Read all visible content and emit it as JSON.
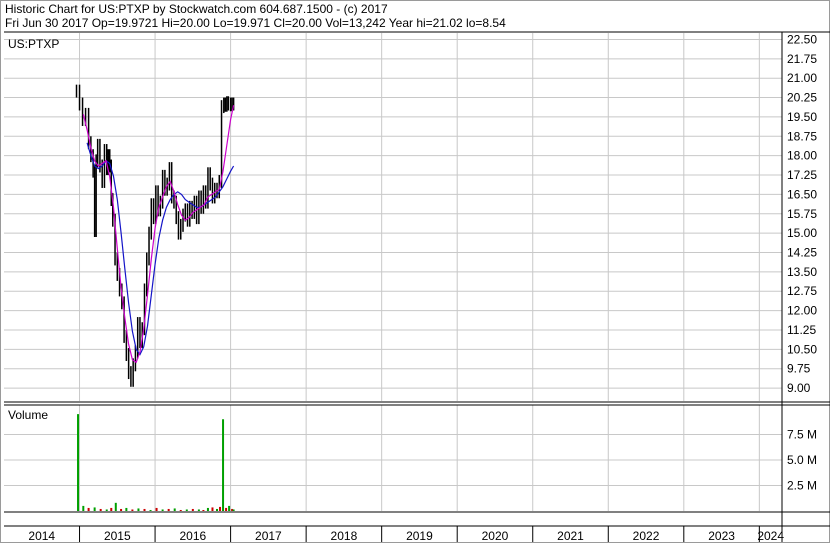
{
  "header": {
    "line1": "Historic Chart for US:PTXP by Stockwatch.com 604.687.1500 - (c) 2017",
    "line2": "Fri Jun 30 2017   Op=19.9721  Hi=20.00   Lo=19.971   Cl=20.00   Vol=13,242   Year hi=21.02   lo=8.54"
  },
  "colors": {
    "grid": "#c8c8c8",
    "price": "#000000",
    "ma_short": "#cc00cc",
    "ma_long": "#1414c8",
    "volume_up": "#00a000",
    "volume_down": "#cc0000",
    "frame": "#000000"
  },
  "chart_data": [
    {
      "type": "line",
      "title": "US:PTXP",
      "ylim": [
        8.5,
        22.75
      ],
      "yticks": [
        "22.50",
        "21.75",
        "21.00",
        "20.25",
        "19.50",
        "18.75",
        "18.00",
        "17.25",
        "16.50",
        "15.75",
        "15.00",
        "14.25",
        "13.50",
        "12.75",
        "12.00",
        "11.25",
        "10.50",
        "9.75",
        "9.00"
      ],
      "xlim": [
        2014.0,
        2024.3
      ],
      "series": [
        {
          "key": "price",
          "x": [
            2014.96,
            2015.0,
            2015.04,
            2015.08,
            2015.12,
            2015.15,
            2015.18,
            2015.2,
            2015.22,
            2015.24,
            2015.27,
            2015.3,
            2015.33,
            2015.36,
            2015.38,
            2015.4,
            2015.42,
            2015.44,
            2015.47,
            2015.5,
            2015.53,
            2015.56,
            2015.59,
            2015.62,
            2015.65,
            2015.68,
            2015.71,
            2015.74,
            2015.77,
            2015.8,
            2015.83,
            2015.86,
            2015.89,
            2015.92,
            2015.95,
            2015.98,
            2016.01,
            2016.04,
            2016.07,
            2016.1,
            2016.13,
            2016.16,
            2016.19,
            2016.22,
            2016.25,
            2016.28,
            2016.31,
            2016.34,
            2016.37,
            2016.4,
            2016.43,
            2016.46,
            2016.49,
            2016.52,
            2016.55,
            2016.58,
            2016.61,
            2016.64,
            2016.67,
            2016.7,
            2016.73,
            2016.76,
            2016.79,
            2016.82,
            2016.85,
            2016.88,
            2016.91,
            2016.93,
            2016.95,
            2016.97,
            2017.0,
            2017.02,
            2017.04
          ],
          "values": [
            20.5,
            20.0,
            19.4,
            19.6,
            18.5,
            18.0,
            17.4,
            15.1,
            17.8,
            18.4,
            17.6,
            17.0,
            18.2,
            17.5,
            18.0,
            17.6,
            16.3,
            15.5,
            14.0,
            13.4,
            12.8,
            12.3,
            11.0,
            10.3,
            9.6,
            9.3,
            9.9,
            10.4,
            11.5,
            10.8,
            11.3,
            12.8,
            14.0,
            15.0,
            16.1,
            15.6,
            16.6,
            15.9,
            16.2,
            17.2,
            16.7,
            16.9,
            17.5,
            16.4,
            16.2,
            15.6,
            15.0,
            15.3,
            15.7,
            15.9,
            15.5,
            16.0,
            15.8,
            16.2,
            15.6,
            16.4,
            16.0,
            16.6,
            16.2,
            17.3,
            16.9,
            16.4,
            16.7,
            16.6,
            17.0,
            19.9,
            20.0,
            19.95,
            20.05,
            20.0,
            19.97,
            20.0,
            20.0
          ]
        },
        {
          "key": "ma_short",
          "x": [
            2015.05,
            2015.1,
            2015.15,
            2015.2,
            2015.25,
            2015.3,
            2015.35,
            2015.4,
            2015.45,
            2015.5,
            2015.55,
            2015.6,
            2015.65,
            2015.7,
            2015.75,
            2015.8,
            2015.85,
            2015.9,
            2015.95,
            2016.0,
            2016.05,
            2016.1,
            2016.15,
            2016.2,
            2016.25,
            2016.3,
            2016.35,
            2016.4,
            2016.45,
            2016.5,
            2016.55,
            2016.6,
            2016.65,
            2016.7,
            2016.75,
            2016.8,
            2016.85,
            2016.9,
            2016.95,
            2017.0,
            2017.04
          ],
          "values": [
            19.6,
            19.0,
            18.3,
            17.8,
            17.6,
            17.7,
            17.8,
            17.2,
            16.0,
            14.4,
            12.9,
            11.7,
            10.7,
            10.1,
            10.0,
            10.4,
            11.3,
            12.6,
            14.0,
            15.2,
            16.0,
            16.4,
            16.8,
            17.0,
            16.6,
            16.1,
            15.7,
            15.5,
            15.6,
            15.8,
            15.9,
            16.0,
            16.1,
            16.4,
            16.5,
            16.6,
            16.7,
            17.4,
            18.4,
            19.4,
            19.95
          ]
        },
        {
          "key": "ma_long",
          "x": [
            2015.1,
            2015.15,
            2015.2,
            2015.25,
            2015.3,
            2015.35,
            2015.4,
            2015.45,
            2015.5,
            2015.55,
            2015.6,
            2015.65,
            2015.7,
            2015.75,
            2015.8,
            2015.85,
            2015.9,
            2015.95,
            2016.0,
            2016.05,
            2016.1,
            2016.15,
            2016.2,
            2016.25,
            2016.3,
            2016.35,
            2016.4,
            2016.45,
            2016.5,
            2016.55,
            2016.6,
            2016.65,
            2016.7,
            2016.75,
            2016.8,
            2016.85,
            2016.9,
            2016.95,
            2017.0,
            2017.04
          ],
          "values": [
            18.5,
            18.0,
            17.6,
            17.5,
            17.6,
            17.8,
            17.7,
            17.2,
            16.3,
            15.0,
            13.6,
            12.3,
            11.2,
            10.5,
            10.3,
            10.6,
            11.4,
            12.6,
            13.8,
            14.8,
            15.5,
            16.0,
            16.3,
            16.5,
            16.6,
            16.5,
            16.3,
            16.2,
            16.1,
            16.0,
            16.0,
            16.1,
            16.2,
            16.3,
            16.4,
            16.6,
            16.8,
            17.1,
            17.4,
            17.6
          ]
        }
      ]
    },
    {
      "type": "bar",
      "title": "Volume",
      "ylim": [
        0,
        10.0
      ],
      "yticks": [
        "7.5 M",
        "5.0 M",
        "2.5 M"
      ],
      "x": [
        2014.98,
        2015.05,
        2015.12,
        2015.2,
        2015.28,
        2015.36,
        2015.42,
        2015.48,
        2015.55,
        2015.62,
        2015.7,
        2015.78,
        2015.86,
        2015.94,
        2016.02,
        2016.1,
        2016.18,
        2016.26,
        2016.34,
        2016.42,
        2016.5,
        2016.58,
        2016.64,
        2016.7,
        2016.76,
        2016.82,
        2016.86,
        2016.9,
        2016.94,
        2016.98,
        2017.02,
        2017.04
      ],
      "values": [
        9.5,
        0.5,
        0.3,
        0.35,
        0.2,
        0.15,
        0.3,
        0.8,
        0.2,
        0.3,
        0.15,
        0.25,
        0.2,
        0.1,
        0.3,
        0.15,
        0.2,
        0.25,
        0.1,
        0.15,
        0.2,
        0.15,
        0.1,
        0.3,
        0.35,
        0.2,
        0.4,
        9.0,
        0.3,
        0.5,
        0.2,
        0.15
      ],
      "up": [
        true,
        true,
        false,
        true,
        false,
        true,
        false,
        true,
        false,
        true,
        false,
        true,
        false,
        true,
        false,
        true,
        false,
        true,
        false,
        true,
        false,
        true,
        false,
        true,
        false,
        true,
        false,
        true,
        false,
        true,
        false,
        true
      ]
    },
    {
      "type": "axis",
      "xticks": [
        "2014",
        "2015",
        "2016",
        "2017",
        "2018",
        "2019",
        "2020",
        "2021",
        "2022",
        "2023",
        "2024"
      ]
    }
  ]
}
